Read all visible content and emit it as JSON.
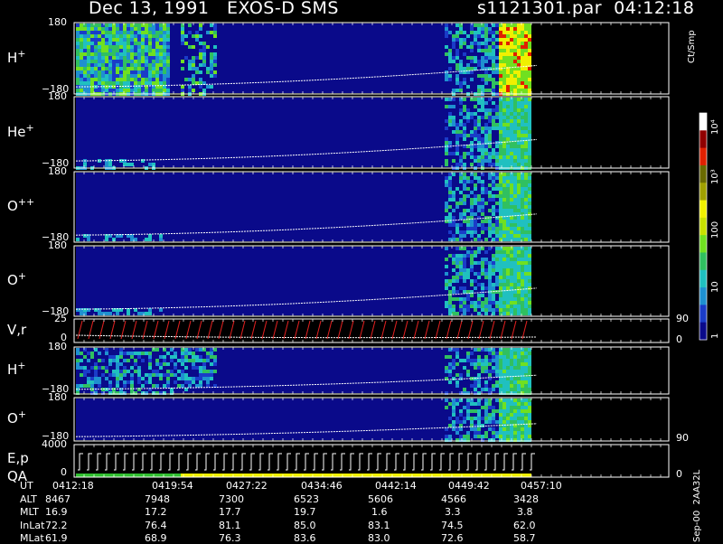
{
  "header": {
    "date_instrument": "Dec 13, 1991   EXOS-D SMS",
    "file_time": "s1121301.par  04:12:18"
  },
  "panels": [
    {
      "label": "H",
      "charge": "+",
      "ymax": "180",
      "ymin": "−180"
    },
    {
      "label": "He",
      "charge": "+",
      "ymax": "180",
      "ymin": "−180"
    },
    {
      "label": "O",
      "charge": "++",
      "ymax": "180",
      "ymin": "−180"
    },
    {
      "label": "O",
      "charge": "+",
      "ymax": "180",
      "ymin": "−180"
    },
    {
      "label": "V,r",
      "charge": "",
      "ymax": "25",
      "ymin": "0",
      "right_top": "90",
      "right_bottom": "0"
    },
    {
      "label": "H",
      "charge": "+",
      "ymax": "180",
      "ymin": "−180"
    },
    {
      "label": "O",
      "charge": "+",
      "ymax": "180",
      "ymin": "−180",
      "right_bottom": "90"
    },
    {
      "label": "E,p\nQA",
      "charge": "",
      "ymax": "4000",
      "ymin": "0",
      "right_bottom": "0"
    }
  ],
  "colorbar": {
    "unit": "Ct/Smp",
    "ticks": [
      "1",
      "10",
      "100",
      "10³",
      "10⁴"
    ],
    "colors": [
      "#0a0a8a",
      "#1a3cc8",
      "#1e90d0",
      "#20c0c0",
      "#30c060",
      "#70e020",
      "#c8e000",
      "#f0f000",
      "#a0a000",
      "#6a6a00",
      "#e02000",
      "#900000",
      "#ffffff"
    ]
  },
  "ephemeris": {
    "labels": [
      "UT",
      "ALT",
      "MLT",
      "InLat",
      "MLat"
    ],
    "columns": [
      {
        "UT": "0412:18",
        "ALT": "8467",
        "MLT": "16.9",
        "InLat": "72.2",
        "MLat": "61.9"
      },
      {
        "UT": "0419:54",
        "ALT": "7948",
        "MLT": "17.2",
        "InLat": "76.4",
        "MLat": "68.9"
      },
      {
        "UT": "0427:22",
        "ALT": "7300",
        "MLT": "17.7",
        "InLat": "81.1",
        "MLat": "76.3"
      },
      {
        "UT": "0434:46",
        "ALT": "6523",
        "MLT": "19.7",
        "InLat": "85.0",
        "MLat": "83.6"
      },
      {
        "UT": "0442:14",
        "ALT": "5606",
        "MLT": "1.6",
        "InLat": "83.1",
        "MLat": "83.0"
      },
      {
        "UT": "0449:42",
        "ALT": "4566",
        "MLT": "3.3",
        "InLat": "74.5",
        "MLat": "72.6"
      },
      {
        "UT": "0457:10",
        "ALT": "3428",
        "MLT": "3.8",
        "InLat": "62.0",
        "MLat": "58.7"
      }
    ]
  },
  "stamp": "Sep-00  2AA32L",
  "chart_data": {
    "type": "heatmap",
    "title": "Dec 13, 1991   EXOS-D SMS",
    "x": [
      "0412:18",
      "0419:54",
      "0427:22",
      "0434:46",
      "0442:14",
      "0449:42",
      "0457:10"
    ],
    "xlabel": "UT",
    "series": [
      {
        "name": "H+",
        "ylim": [
          -180,
          180
        ]
      },
      {
        "name": "He+",
        "ylim": [
          -180,
          180
        ]
      },
      {
        "name": "O++",
        "ylim": [
          -180,
          180
        ]
      },
      {
        "name": "O+",
        "ylim": [
          -180,
          180
        ]
      },
      {
        "name": "V,r",
        "ylim": [
          0,
          25
        ]
      },
      {
        "name": "H+",
        "ylim": [
          -180,
          180
        ]
      },
      {
        "name": "O+",
        "ylim": [
          -180,
          180
        ]
      },
      {
        "name": "E,p QA",
        "ylim": [
          0,
          4000
        ]
      }
    ],
    "colorbar_unit": "Ct/Smp",
    "colorbar_range": [
      1,
      10000
    ],
    "colorbar_scale": "log"
  }
}
